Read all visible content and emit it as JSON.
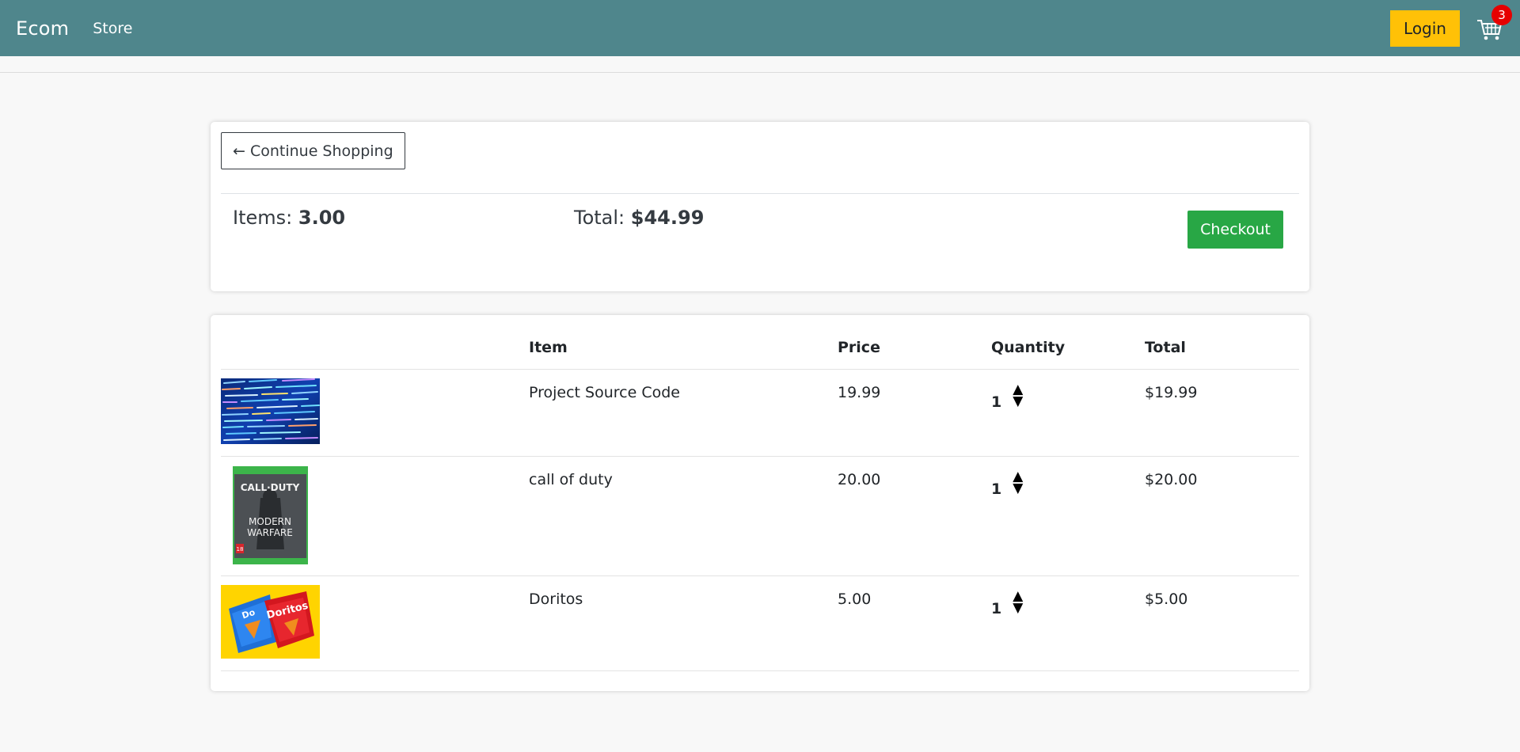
{
  "nav": {
    "brand": "Ecom",
    "store_link": "Store",
    "login_label": "Login",
    "cart_count": "3"
  },
  "summary": {
    "continue_label": "← Continue Shopping",
    "items_label": "Items:",
    "items_value": "3.00",
    "total_label": "Total:",
    "total_value": "$44.99",
    "checkout_label": "Checkout"
  },
  "table": {
    "headers": [
      "",
      "Item",
      "Price",
      "Quantity",
      "Total"
    ],
    "rows": [
      {
        "item": "Project Source Code",
        "price": "19.99",
        "quantity": "1",
        "total": "$19.99",
        "image": "code-screenshot-image"
      },
      {
        "item": "call of duty",
        "price": "20.00",
        "quantity": "1",
        "total": "$20.00",
        "image": "call-of-duty-cover-image"
      },
      {
        "item": "Doritos",
        "price": "5.00",
        "quantity": "1",
        "total": "$5.00",
        "image": "doritos-bags-image"
      }
    ],
    "arrow_up": "▲",
    "arrow_down": "▼"
  },
  "colors": {
    "navbar": "#4f868c",
    "login": "#ffc107",
    "checkout": "#28a745",
    "badge": "#e60000"
  }
}
